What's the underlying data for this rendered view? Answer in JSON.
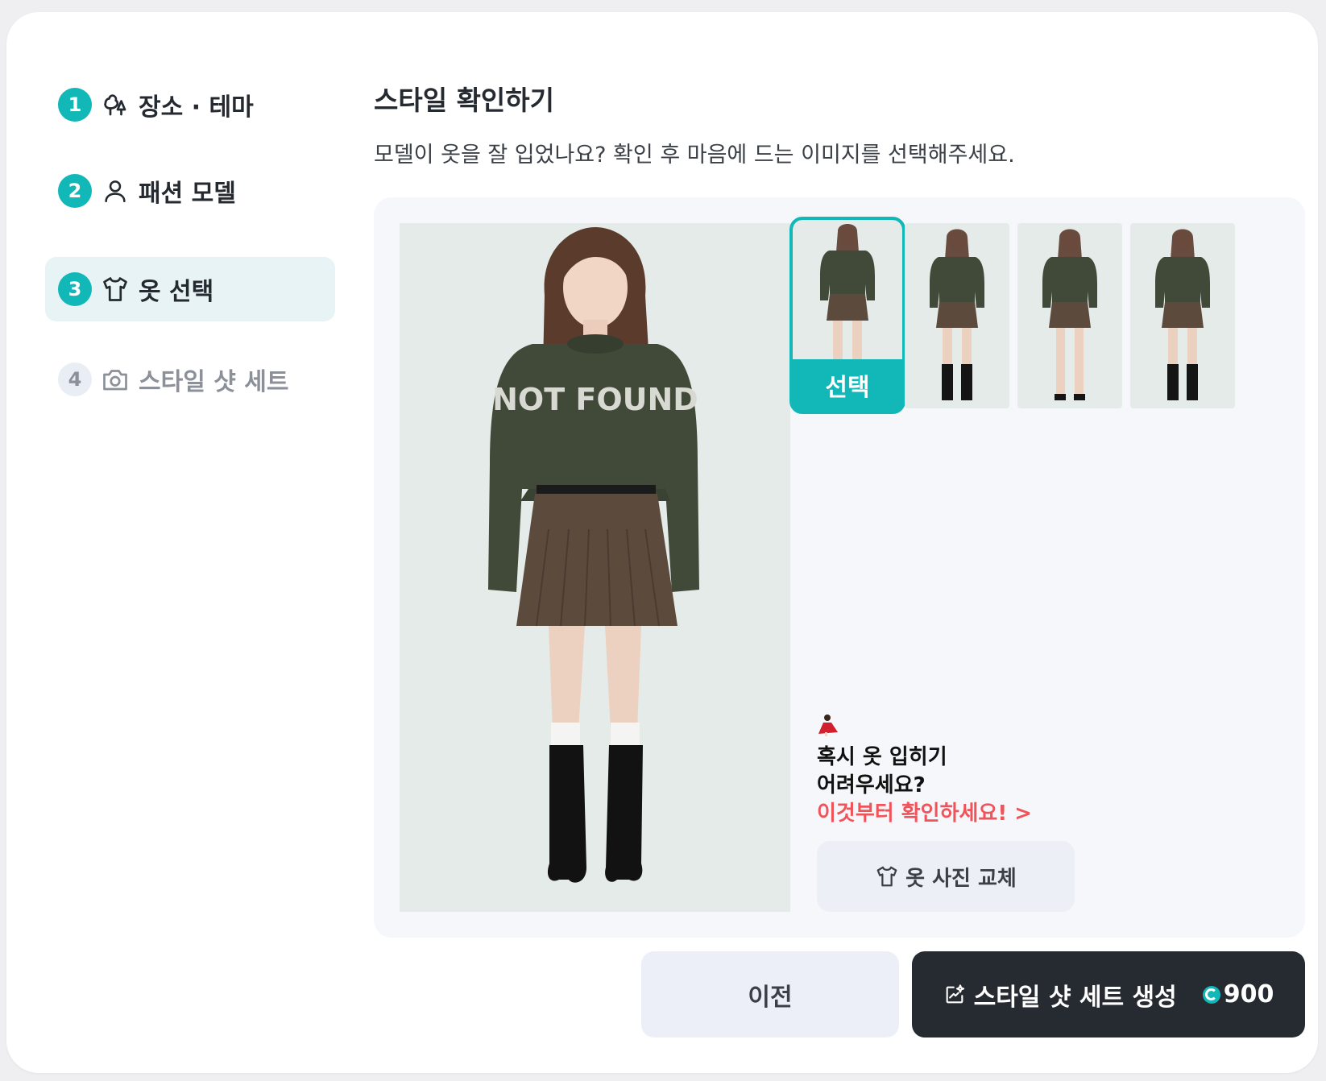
{
  "stepper": {
    "steps": [
      {
        "number": "1",
        "label": "장소 · 테마",
        "icon": "trees-icon",
        "state": "done"
      },
      {
        "number": "2",
        "label": "패션 모델",
        "icon": "person-icon",
        "state": "done"
      },
      {
        "number": "3",
        "label": "옷 선택",
        "icon": "shirt-icon",
        "state": "active"
      },
      {
        "number": "4",
        "label": "스타일 샷 세트",
        "icon": "camera-icon",
        "state": "disabled"
      }
    ]
  },
  "header": {
    "title": "스타일 확인하기",
    "subtitle": "모델이 옷을 잘 입었나요? 확인 후 마음에 드는 이미지를 선택해주세요."
  },
  "preview": {
    "main_alt": "NOT FOUND",
    "thumbnails_count_text": "",
    "selected_label": "선택"
  },
  "help": {
    "emoji": "dancer-emoji",
    "line1": "혹시 옷 입히기",
    "line2": "어려우세요?",
    "link": "이것부터 확인하세요! >"
  },
  "actions": {
    "replace_label": "옷 사진 교체",
    "prev_label": "이전",
    "generate_label": "스타일 샷 세트 생성",
    "cost": "900"
  },
  "colors": {
    "accent": "#12b7b7",
    "dark_button": "#262a31",
    "link_red": "#f0545b"
  }
}
